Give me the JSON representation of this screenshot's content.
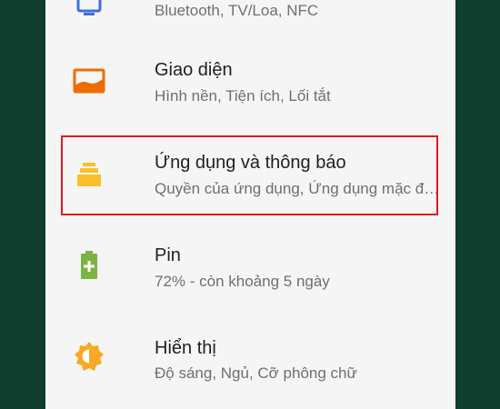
{
  "settings": {
    "items": [
      {
        "title": "",
        "subtitle": "Bluetooth, TV/Loa, NFC",
        "icon": "connected-devices-icon"
      },
      {
        "title": "Giao diện",
        "subtitle": "Hình nền, Tiện ích, Lối tắt",
        "icon": "display-wallpaper-icon"
      },
      {
        "title": "Ứng dụng và thông báo",
        "subtitle": "Quyền của ứng dụng, Ứng dụng mặc định",
        "icon": "apps-icon"
      },
      {
        "title": "Pin",
        "subtitle": "72% - còn khoảng 5 ngày",
        "icon": "battery-icon"
      },
      {
        "title": "Hiển thị",
        "subtitle": "Độ sáng, Ngủ, Cỡ phông chữ",
        "icon": "brightness-icon"
      }
    ]
  },
  "colors": {
    "background": "#0f3d2e",
    "panel": "#f5f5f5",
    "highlight_border": "#e01b1b",
    "wallpaper_icon": "#ef6c00",
    "apps_icon": "#f9c02d",
    "battery_icon": "#7cb342",
    "brightness_icon": "#f9a825"
  }
}
